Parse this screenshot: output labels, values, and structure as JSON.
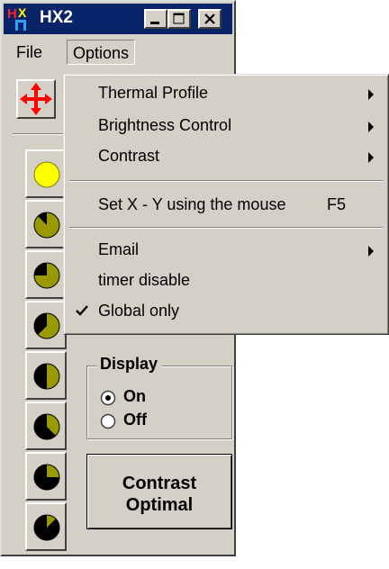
{
  "window": {
    "title": "HX2",
    "app_icon_letters": "HX"
  },
  "menubar": {
    "file_label": "File",
    "options_label": "Options"
  },
  "options_menu": {
    "items": [
      {
        "label": "Thermal Profile",
        "submenu": true
      },
      {
        "label": "Brightness Control",
        "submenu": true
      },
      {
        "label": "Contrast",
        "submenu": true
      },
      {
        "label": "Set X - Y using the mouse",
        "shortcut": "F5"
      },
      {
        "label": "Email",
        "submenu": true
      },
      {
        "label": "timer disable"
      },
      {
        "label": "Global only",
        "checked": true
      }
    ]
  },
  "display_group": {
    "legend": "Display",
    "on_label": "On",
    "off_label": "Off",
    "selected": "On"
  },
  "contrast_button": {
    "line1": "Contrast",
    "line2": "Optimal"
  },
  "brightness_levels": [
    {
      "icon": "full-circle-icon",
      "fill": 1.0
    },
    {
      "icon": "pie-level-icon",
      "fill": 0.875
    },
    {
      "icon": "pie-level-icon",
      "fill": 0.75
    },
    {
      "icon": "pie-level-icon",
      "fill": 0.625
    },
    {
      "icon": "pie-level-icon",
      "fill": 0.5
    },
    {
      "icon": "pie-level-icon",
      "fill": 0.375
    },
    {
      "icon": "pie-level-icon",
      "fill": 0.25
    },
    {
      "icon": "pie-level-icon",
      "fill": 0.125
    }
  ],
  "colors": {
    "titlebar": "#0a246a",
    "face": "#d4d0c8",
    "indicator_light": "#ffff00",
    "indicator_olive": "#999900",
    "move_arrows": "#ff0000"
  }
}
